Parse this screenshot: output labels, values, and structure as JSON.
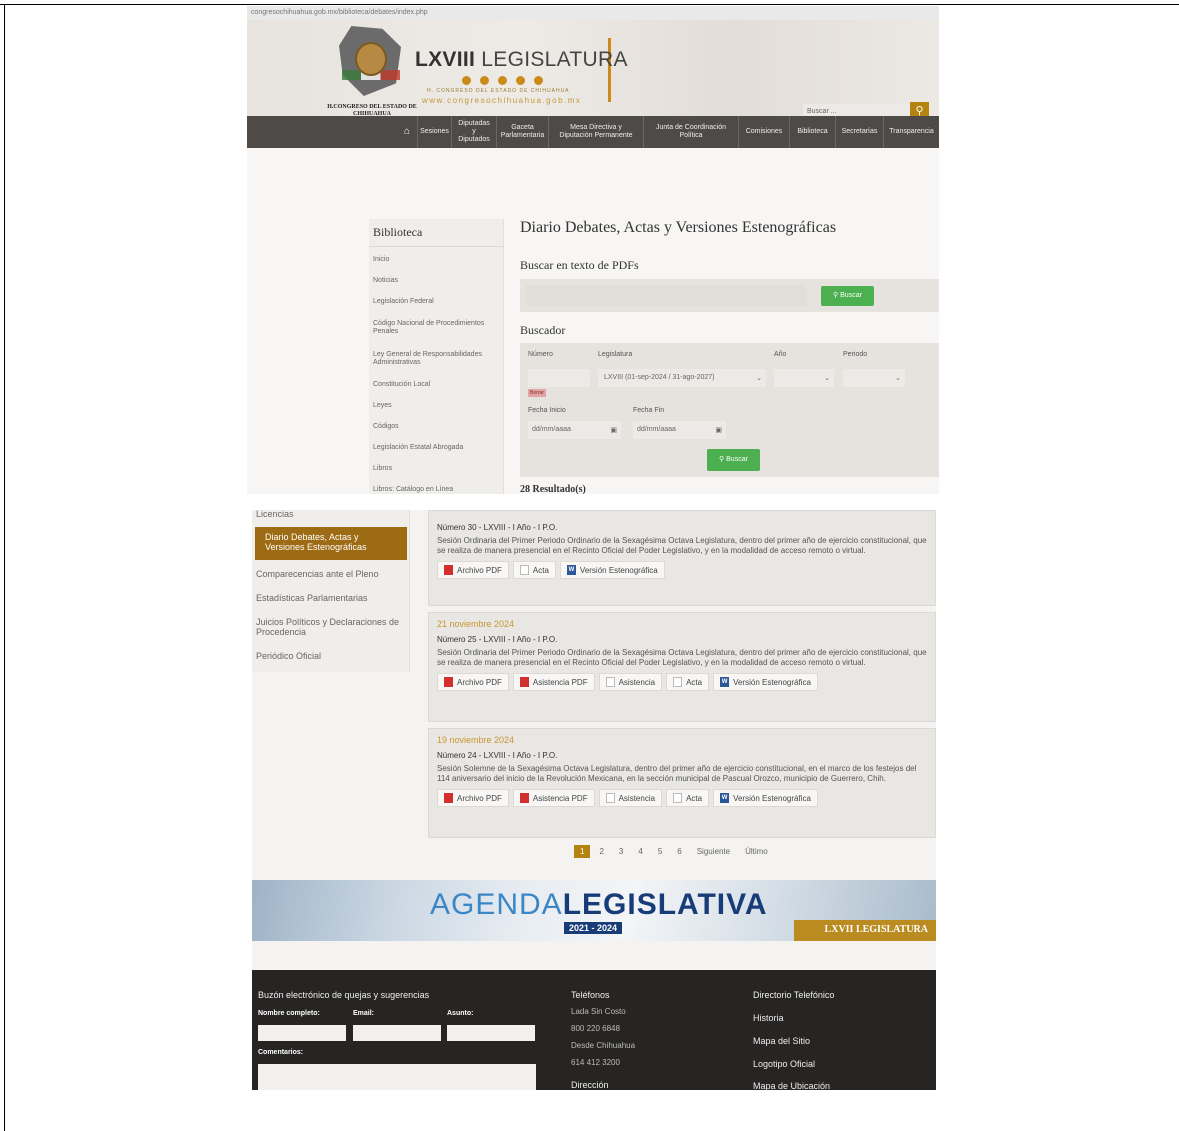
{
  "browser": {
    "url": "congresochihuahua.gob.mx/biblioteca/debates/index.php"
  },
  "header": {
    "congreso_name": "H.CONGRESO DEL ESTADO DE CHIHUAHUA",
    "leg_title_bold": "LXVIII",
    "leg_title_rest": " LEGISLATURA",
    "leg_sub": "H. CONGRESO DEL ESTADO DE CHIHUAHUA",
    "leg_url": "www.congresochihuahua.gob.mx",
    "search_placeholder": "Buscar ...",
    "colors": {
      "gold": "#b5830f",
      "nav_bg": "#4e4a47"
    }
  },
  "nav": {
    "home_icon": "home-icon",
    "items": [
      "Sesiones",
      "Diputadas y Diputados",
      "Gaceta Parlamentaria",
      "Mesa Directiva y Diputación Permanente",
      "Junta de Coordinación Política",
      "Comisiones",
      "Biblioteca",
      "Secretarías",
      "Transparencia"
    ]
  },
  "sidebar": {
    "title": "Biblioteca",
    "items": [
      "Inicio",
      "Noticias",
      "Legislación Federal",
      "Código Nacional de Procedimientos Penales",
      "Ley General de Responsabilidades Administrativas",
      "Constitución Local",
      "Leyes",
      "Códigos",
      "Legislación Estatal Abrogada",
      "Libros",
      "Libros: Catálogo en Línea"
    ]
  },
  "main": {
    "title": "Diario Debates, Actas y Versiones Estenográficas",
    "pdf_search_heading": "Buscar en texto de PDFs",
    "buscar_btn": "Buscar",
    "buscador_heading": "Buscador",
    "labels": {
      "numero": "Número",
      "legislatura": "Legislatura",
      "anio": "Año",
      "periodo": "Periodo",
      "fecha_inicio": "Fecha Inicio",
      "fecha_fin": "Fecha Fin"
    },
    "legislatura_selected": "LXVIII (01-sep-2024 / 31-ago-2027)",
    "borrar": "Borrar",
    "date_placeholder": "dd/mm/aaaa",
    "results": "28 Resultado(s)"
  },
  "sidebar2": {
    "items_top": [
      "Licencias"
    ],
    "active": "Diario Debates, Actas y Versiones Estenográficas",
    "items_bottom": [
      "Comparecencias ante el Pleno",
      "Estadísticas Parlamentarias",
      "Juicios Políticos y Declaraciones de Procedencia",
      "Periódico Oficial"
    ]
  },
  "records": [
    {
      "date": "",
      "number": "Número 30 - LXVIII - I Año - I P.O.",
      "desc": "Sesión Ordinaria del Primer Periodo Ordinario de la Sexagésima Octava Legislatura, dentro del primer año de ejercicio constitucional, que se realiza de manera presencial en el Recinto Oficial del Poder Legislativo, y en la modalidad de acceso remoto o virtual.",
      "buttons": [
        "Archivo PDF",
        "Acta",
        "Versión Estenográfica"
      ]
    },
    {
      "date": "21 noviembre 2024",
      "number": "Número 25 - LXVIII - I Año - I P.O.",
      "desc": "Sesión Ordinaria del Primer Periodo Ordinario de la Sexagésima Octava Legislatura, dentro del primer año de ejercicio constitucional, que se realiza de manera presencial en el Recinto Oficial del Poder Legislativo, y en la modalidad de acceso remoto o virtual.",
      "buttons": [
        "Archivo PDF",
        "Asistencia PDF",
        "Asistencia",
        "Acta",
        "Versión Estenográfica"
      ]
    },
    {
      "date": "19 noviembre 2024",
      "number": "Número 24 - LXVIII - I Año - I P.O.",
      "desc": "Sesión Solemne de la Sexagésima Octava Legislatura, dentro del primer año de ejercicio constitucional, en el marco de los festejos del 114 aniversario del inicio de la Revolución Mexicana, en la sección municipal de Pascual Orozco, municipio de Guerrero, Chih.",
      "buttons": [
        "Archivo PDF",
        "Asistencia PDF",
        "Asistencia",
        "Acta",
        "Versión Estenográfica"
      ]
    }
  ],
  "pagination": {
    "pages": [
      "1",
      "2",
      "3",
      "4",
      "5",
      "6"
    ],
    "next": "Siguiente",
    "last": "Último"
  },
  "banner": {
    "title_light": "AGENDA",
    "title_bold": "LEGISLATIVA",
    "years": "2021 - 2024",
    "legislatura": "LXVII LEGISLATURA"
  },
  "footer": {
    "buzon_title": "Buzón electrónico de quejas y sugerencias",
    "nombre": "Nombre completo:",
    "email": "Email:",
    "asunto": "Asunto:",
    "comentarios": "Comentarios:",
    "telefonos": "Teléfonos",
    "lada": "Lada Sin Costo",
    "tel1": "800 220 6848",
    "desde": "Desde Chihuahua",
    "tel2": "614 412 3200",
    "direccion": "Dirección",
    "links": [
      "Directorio Telefónico",
      "Historia",
      "Mapa del Sitio",
      "Logotipo Oficial",
      "Mapa de Ubicación"
    ]
  }
}
